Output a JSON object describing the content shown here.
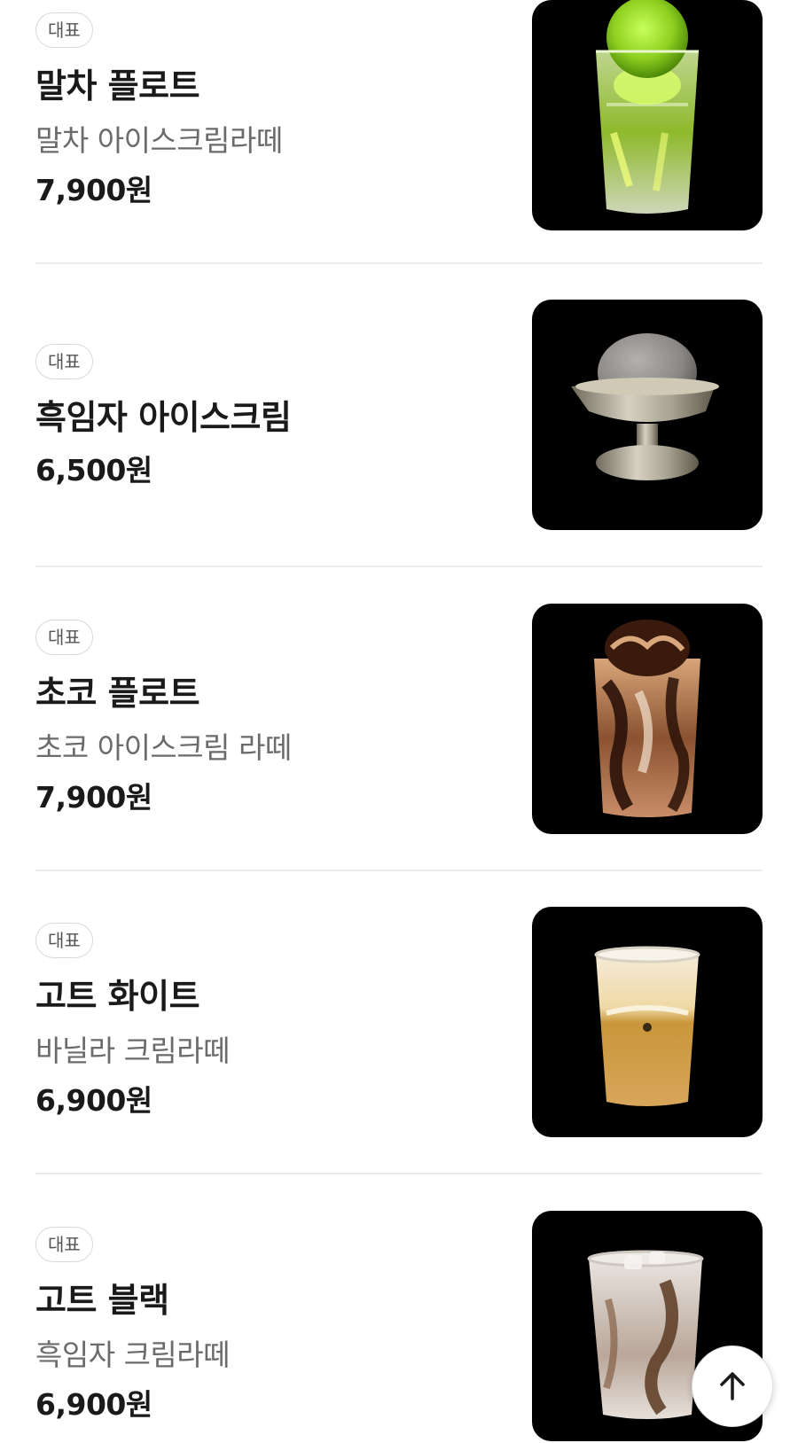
{
  "menu": {
    "items": [
      {
        "badge": "대표",
        "name": "말차 플로트",
        "description": "말차 아이스크림라떼",
        "price": "7,900원",
        "image_icon": "matcha-float-icon"
      },
      {
        "badge": "대표",
        "name": "흑임자 아이스크림",
        "description": "",
        "price": "6,500원",
        "image_icon": "black-sesame-ice-cream-icon"
      },
      {
        "badge": "대표",
        "name": "초코 플로트",
        "description": "초코 아이스크림 라떼",
        "price": "7,900원",
        "image_icon": "choco-float-icon"
      },
      {
        "badge": "대표",
        "name": "고트 화이트",
        "description": "바닐라 크림라떼",
        "price": "6,900원",
        "image_icon": "goat-white-icon"
      },
      {
        "badge": "대표",
        "name": "고트 블랙",
        "description": "흑임자 크림라떼",
        "price": "6,900원",
        "image_icon": "goat-black-icon"
      }
    ]
  },
  "scroll_top_button": {
    "icon": "arrow-up-icon"
  },
  "colors": {
    "text_primary": "#1a1a1a",
    "text_secondary": "#6b6b6b",
    "badge_border": "#d9d9d9",
    "divider": "#ececec",
    "thumbnail_background": "#000000"
  }
}
